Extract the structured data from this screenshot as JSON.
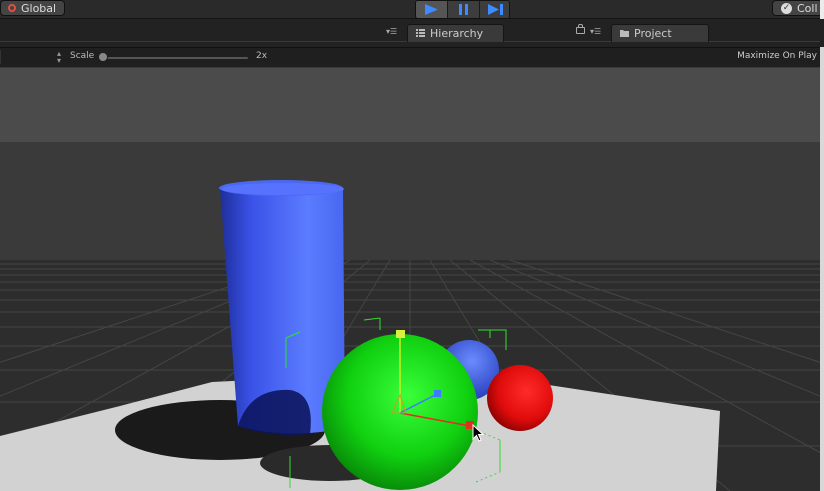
{
  "toolbar": {
    "global_label": "Global",
    "collab_label": "Coll",
    "play_icons": [
      "play-icon",
      "pause-icon",
      "step-icon"
    ]
  },
  "tabs": {
    "hierarchy_label": "Hierarchy",
    "project_label": "Project"
  },
  "game_view": {
    "scale_label": "Scale",
    "scale_value": "2x",
    "scale_level": 0.0,
    "maximize_label": "Maximize On Play"
  },
  "scene": {
    "sky_color": "#474747",
    "horizon_color": "#3a3a3a",
    "ground_color": "#2a2a2a",
    "plane_color": "#d0d0d0",
    "cylinder_color": "#4a68ff",
    "green_sphere_color": "#14e014",
    "blue_sphere_color": "#4f72ff",
    "red_sphere_color": "#ff1a1a",
    "gizmo_colors": {
      "x": "#e03020",
      "y": "#c8f020",
      "z": "#3a7cff",
      "bounds": "#2fe02f"
    }
  }
}
